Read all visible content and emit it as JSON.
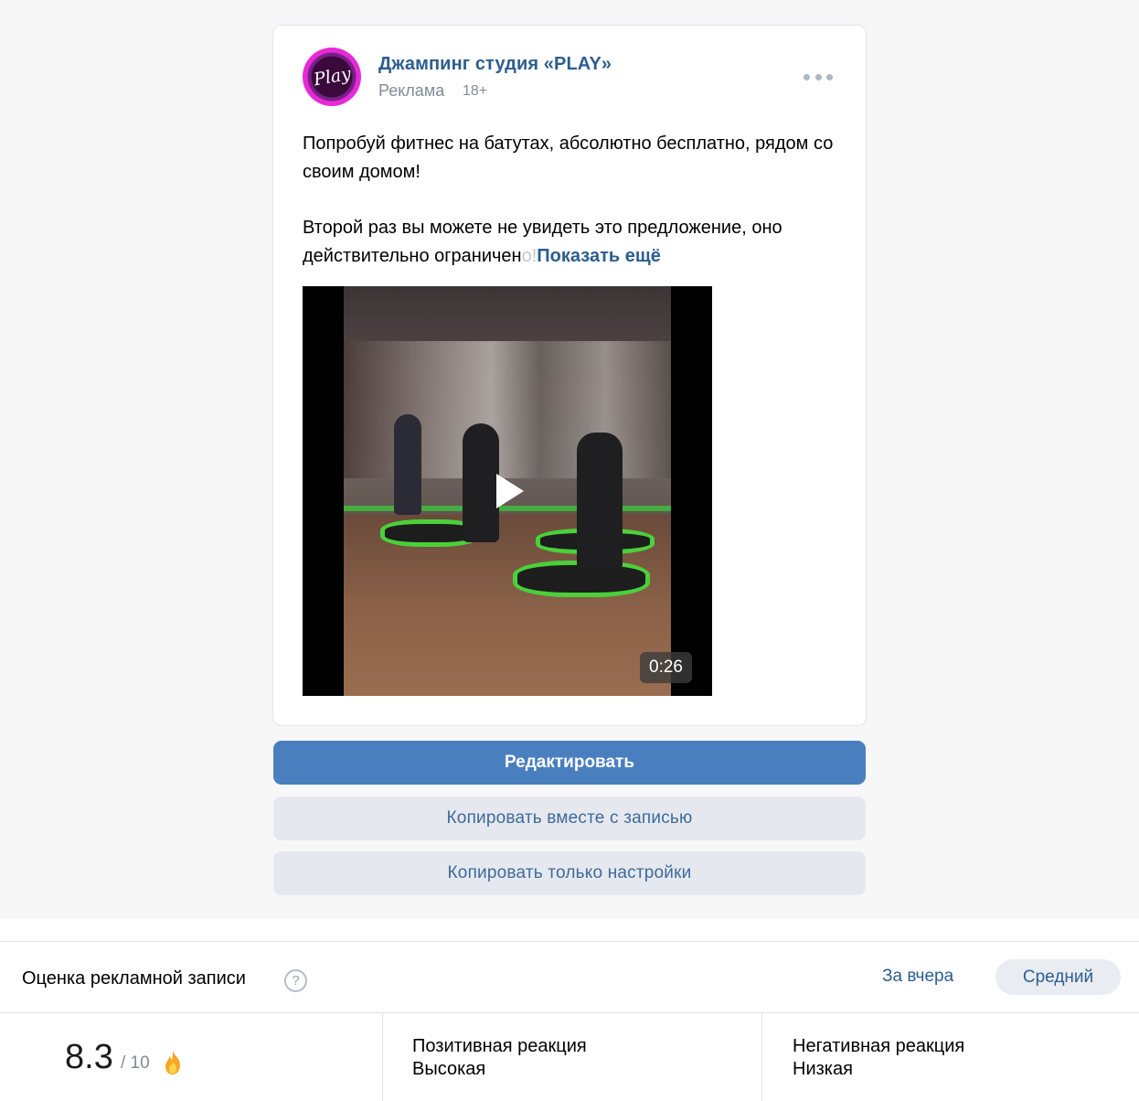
{
  "post": {
    "community_name": "Джампинг студия «PLAY»",
    "avatar_text": "Play",
    "ad_label": "Реклама",
    "age_label": "18+",
    "more_icon": "more-horizontal-icon",
    "text_line1": "Попробуй фитнес на батутах, абсолютно бесплатно, рядом со своим домом!",
    "text_line2_main": "Второй раз вы можете не увидеть это предложение, оно действительно ограничен",
    "text_line2_fade": "о!",
    "show_more": "Показать ещё",
    "video": {
      "duration": "0:26",
      "play_icon": "play-icon"
    }
  },
  "actions": {
    "edit": "Редактировать",
    "copy_with_post": "Копировать вместе с записью",
    "copy_settings_only": "Копировать только настройки"
  },
  "rating": {
    "title": "Оценка рекламной записи",
    "help": "?",
    "period_link": "За вчера",
    "level_chip": "Средний",
    "score": "8.3",
    "score_max": "/ 10",
    "score_icon": "fire-icon",
    "positive_label": "Позитивная реакция",
    "positive_value": "Высокая",
    "negative_label": "Негативная реакция",
    "negative_value": "Низкая"
  },
  "colors": {
    "link": "#2c5d8f",
    "primary_button": "#4a7fbf",
    "secondary_button": "#e5e9ef",
    "page_background": "#f7f7f8"
  }
}
